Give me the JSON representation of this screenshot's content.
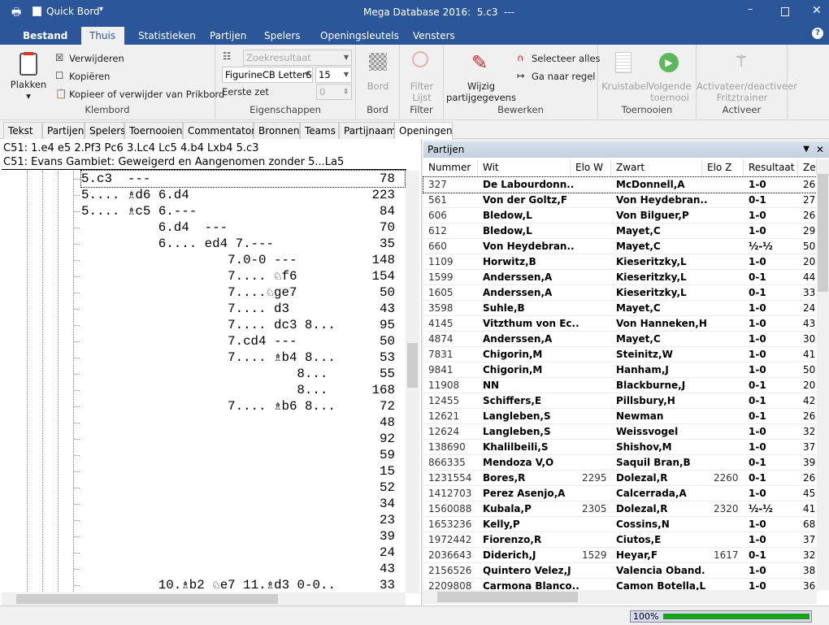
{
  "app": {
    "title": "Mega Database 2016:  5.c3  ---",
    "quick_access": "Quick Bord",
    "colors": {
      "accent": "#2b579a",
      "progress": "#1aa01a"
    }
  },
  "ribbon_tabs": [
    "Bestand",
    "Thuis",
    "Statistieken",
    "Partijen",
    "Spelers",
    "Openingsleutels",
    "Vensters"
  ],
  "ribbon": {
    "klembord": {
      "label": "Klembord",
      "paste": "Plakken",
      "delete": "Verwijderen",
      "copy": "Kopiëren",
      "clipboard": "Kopieer of verwijder van Prikbord"
    },
    "eigenschappen": {
      "label": "Eigenschappen",
      "search_result": "Zoekresultaat",
      "font": "FigurineCB LetterS",
      "size": "15",
      "first_move_label": "Eerste zet",
      "first_move": "0"
    },
    "bord": {
      "label": "Bord",
      "button": "Bord"
    },
    "filter": {
      "label": "Filter",
      "button": "Filter Lijst"
    },
    "bewerken": {
      "label": "Bewerken",
      "edit": "Wijzig partijgegevens",
      "select_all": "Selecteer alles",
      "goto_line": "Ga naar regel"
    },
    "toernooien": {
      "label": "Toernooien",
      "crosstable": "Kruistabel",
      "next": "Volgende toernooi"
    },
    "activeer": {
      "label": "Activeer",
      "fritz": "Activateer/deactiveer Fritztrainer"
    }
  },
  "doc_tabs": [
    "Tekst",
    "Partijen",
    "Spelers",
    "Toernooien",
    "Commentator",
    "Bronnen",
    "Teams",
    "Partijnaam",
    "Openingen"
  ],
  "openings": {
    "line1": "C51: 1.e4 e5 2.Pf3 Pc6 3.Lc4 Lc5 4.b4 Lxb4 5.c3",
    "line2": "C51: Evans Gambiet: Geweigerd en Aangenomen zonder 5...La5",
    "rows": [
      {
        "text": "5.c3  ---",
        "count": "78"
      },
      {
        "text": "5.... ♗d6 6.d4",
        "count": "223"
      },
      {
        "text": "5.... ♗c5 6.---",
        "count": "84"
      },
      {
        "text": "          6.d4  ---",
        "count": "70"
      },
      {
        "text": "          6.... ed4 7.---",
        "count": "35"
      },
      {
        "text": "                   7.0-0 ---",
        "count": "148"
      },
      {
        "text": "                   7.... ♘f6",
        "count": "154"
      },
      {
        "text": "                   7....♘ge7",
        "count": "50"
      },
      {
        "text": "                   7.... d3",
        "count": "43"
      },
      {
        "text": "                   7.... dc3 8...",
        "count": "95"
      },
      {
        "text": "                   7.cd4 ---",
        "count": "50"
      },
      {
        "text": "                   7.... ♗b4 8...",
        "count": "53"
      },
      {
        "text": "                            8...",
        "count": "55"
      },
      {
        "text": "                            8...",
        "count": "168"
      },
      {
        "text": "                   7.... ♗b6 8...",
        "count": "72"
      },
      {
        "text": "",
        "count": "48"
      },
      {
        "text": "",
        "count": "92"
      },
      {
        "text": "",
        "count": "59"
      },
      {
        "text": "",
        "count": "15"
      },
      {
        "text": "",
        "count": "52"
      },
      {
        "text": "",
        "count": "34"
      },
      {
        "text": "",
        "count": "23"
      },
      {
        "text": "",
        "count": "39"
      },
      {
        "text": "",
        "count": "24"
      },
      {
        "text": "",
        "count": "43"
      },
      {
        "text": "          10.♗b2 ♘e7 11.♗d3 0-0..",
        "count": "33"
      }
    ]
  },
  "games": {
    "title": "Partijen",
    "columns": [
      "Nummer",
      "Wit",
      "Elo W",
      "Zwart",
      "Elo Z",
      "Resultaat",
      "Ze"
    ],
    "rows": [
      [
        "327",
        "De Labourdonn..",
        "",
        "McDonnell,A",
        "",
        "1-0",
        "26"
      ],
      [
        "561",
        "Von der Goltz,F",
        "",
        "Von Heydebran..",
        "",
        "0-1",
        "27"
      ],
      [
        "606",
        "Bledow,L",
        "",
        "Von Bilguer,P",
        "",
        "1-0",
        "26"
      ],
      [
        "612",
        "Bledow,L",
        "",
        "Mayet,C",
        "",
        "1-0",
        "29"
      ],
      [
        "660",
        "Von Heydebran..",
        "",
        "Mayet,C",
        "",
        "½-½",
        "50"
      ],
      [
        "1109",
        "Horwitz,B",
        "",
        "Kieseritzky,L",
        "",
        "1-0",
        "20"
      ],
      [
        "1599",
        "Anderssen,A",
        "",
        "Kieseritzky,L",
        "",
        "0-1",
        "44"
      ],
      [
        "1605",
        "Anderssen,A",
        "",
        "Kieseritzky,L",
        "",
        "0-1",
        "33"
      ],
      [
        "3598",
        "Suhle,B",
        "",
        "Mayet,C",
        "",
        "1-0",
        "24"
      ],
      [
        "4145",
        "Vitzthum von Ec..",
        "",
        "Von Hanneken,H",
        "",
        "1-0",
        "43"
      ],
      [
        "4874",
        "Anderssen,A",
        "",
        "Mayet,C",
        "",
        "1-0",
        "30"
      ],
      [
        "7831",
        "Chigorin,M",
        "",
        "Steinitz,W",
        "",
        "1-0",
        "41"
      ],
      [
        "9841",
        "Chigorin,M",
        "",
        "Hanham,J",
        "",
        "1-0",
        "50"
      ],
      [
        "11908",
        "NN",
        "",
        "Blackburne,J",
        "",
        "0-1",
        "20"
      ],
      [
        "12455",
        "Schiffers,E",
        "",
        "Pillsbury,H",
        "",
        "0-1",
        "42"
      ],
      [
        "12621",
        "Langleben,S",
        "",
        "Newman",
        "",
        "0-1",
        "26"
      ],
      [
        "12624",
        "Langleben,S",
        "",
        "Weissvogel",
        "",
        "1-0",
        "32"
      ],
      [
        "138690",
        "Khalilbeili,S",
        "",
        "Shishov,M",
        "",
        "1-0",
        "37"
      ],
      [
        "866335",
        "Mendoza V,O",
        "",
        "Saquil Bran,B",
        "",
        "0-1",
        "39"
      ],
      [
        "1231554",
        "Bores,R",
        "2295",
        "Dolezal,R",
        "2260",
        "0-1",
        "26"
      ],
      [
        "1412703",
        "Perez Asenjo,A",
        "",
        "Calcerrada,A",
        "",
        "1-0",
        "45"
      ],
      [
        "1560088",
        "Kubala,P",
        "2305",
        "Dolezal,R",
        "2320",
        "½-½",
        "41"
      ],
      [
        "1653236",
        "Kelly,P",
        "",
        "Cossins,N",
        "",
        "1-0",
        "68"
      ],
      [
        "1972442",
        "Fiorenzo,R",
        "",
        "Ciutos,E",
        "",
        "1-0",
        "37"
      ],
      [
        "2036643",
        "Diderich,J",
        "1529",
        "Heyar,F",
        "1617",
        "0-1",
        "32"
      ],
      [
        "2156526",
        "Quintero Velez,J",
        "",
        "Valencia Oband.",
        "",
        "1-0",
        "38"
      ],
      [
        "2209808",
        "Carmona Blanco..",
        "",
        "Camon Botella,L",
        "",
        "1-0",
        "36"
      ]
    ]
  },
  "status": {
    "progress_label": "100%",
    "progress": 100
  }
}
